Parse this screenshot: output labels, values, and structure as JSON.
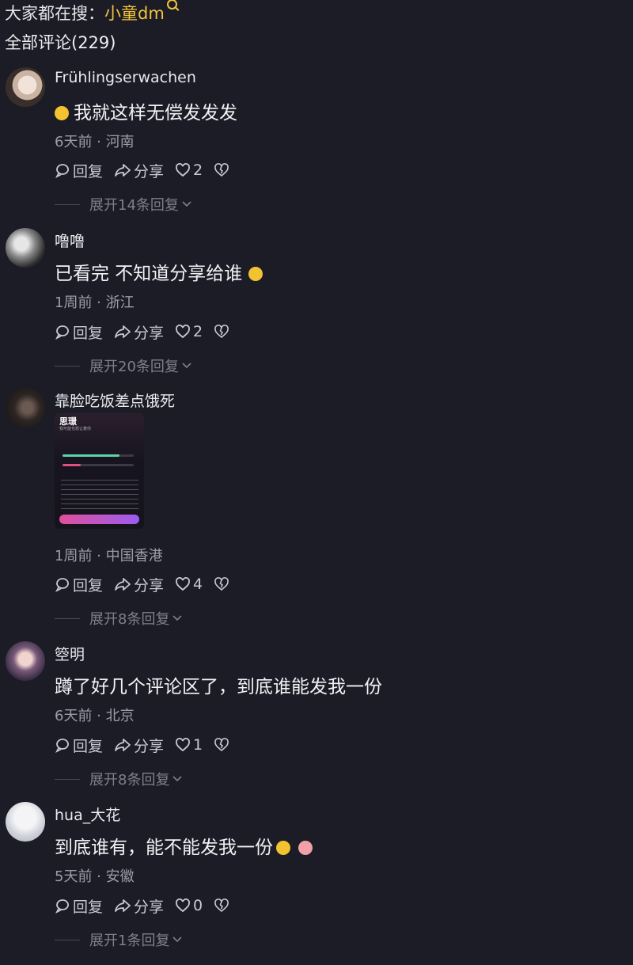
{
  "search": {
    "prefix": "大家都在搜：",
    "keyword": "小童dm"
  },
  "comments_title": "全部评论(229)",
  "comments": [
    {
      "nick": "Frühlingserwachen",
      "text": "我就这样无偿发发发",
      "time_location": "6天前 · 河南",
      "reply": "回复",
      "share": "分享",
      "likes": "2",
      "expand": "展开14条回复"
    },
    {
      "nick": "噜噜",
      "text": "已看完 不知道分享给谁",
      "time_location": "1周前 · 浙江",
      "reply": "回复",
      "share": "分享",
      "likes": "2",
      "expand": "展开20条回复"
    },
    {
      "nick": "靠脸吃饭差点饿死",
      "text": "",
      "time_location": "1周前 · 中国香港",
      "reply": "回复",
      "share": "分享",
      "likes": "4",
      "expand": "展开8条回复",
      "image_title": "思璟",
      "image_subtitle": "我可能也想让着你"
    },
    {
      "nick": "箜明",
      "text": "蹲了好几个评论区了，到底谁能发我一份",
      "time_location": "6天前 · 北京",
      "reply": "回复",
      "share": "分享",
      "likes": "1",
      "expand": "展开8条回复"
    },
    {
      "nick": "hua_大花",
      "text": "到底谁有，能不能发我一份",
      "time_location": "5天前 · 安徽",
      "reply": "回复",
      "share": "分享",
      "likes": "0",
      "expand": "展开1条回复"
    }
  ]
}
